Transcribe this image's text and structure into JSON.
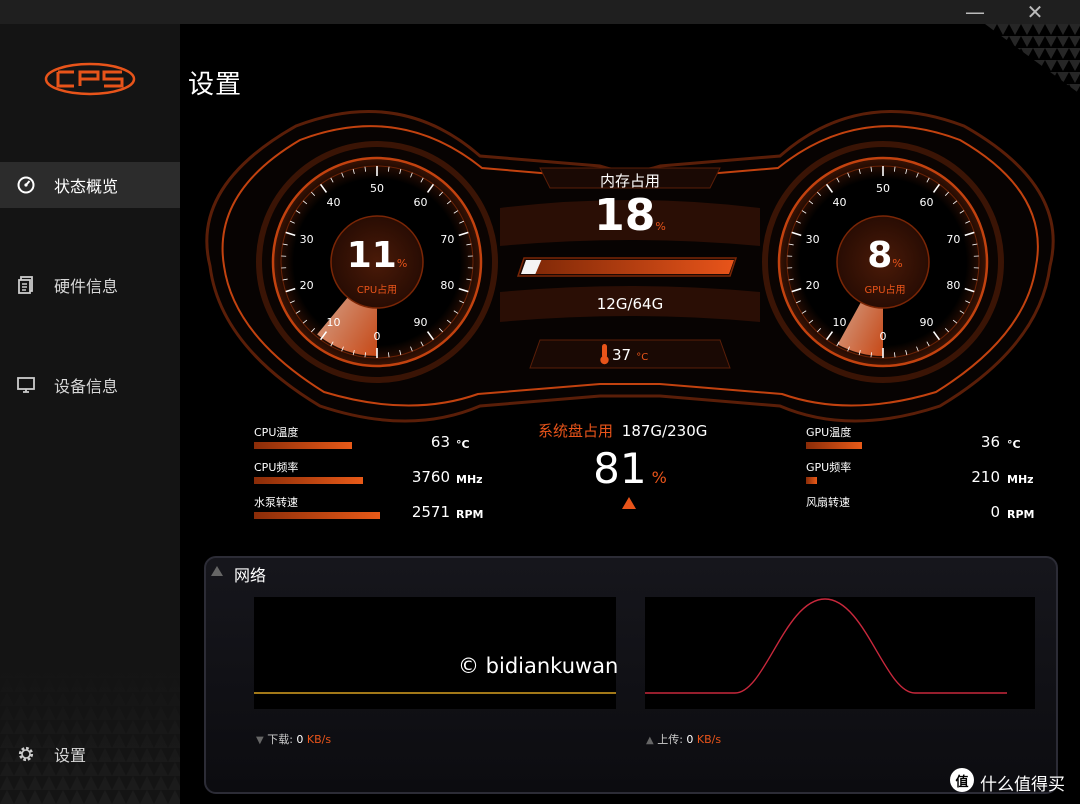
{
  "window": {
    "minimize_symbol": "—",
    "close_symbol": "✕"
  },
  "brand": {
    "logo_text": "CPS"
  },
  "sidebar": {
    "items": [
      {
        "label": "状态概览",
        "icon": "speedometer-icon",
        "active": true
      },
      {
        "label": "硬件信息",
        "icon": "document-icon",
        "active": false
      },
      {
        "label": "设备信息",
        "icon": "monitor-icon",
        "active": false
      }
    ],
    "settings_label": "设置"
  },
  "page": {
    "title": "设置"
  },
  "cpu": {
    "usage": "11",
    "usage_unit": "%",
    "gauge_label": "CPU占用",
    "gauge_ticks": [
      "0",
      "10",
      "20",
      "30",
      "40",
      "50",
      "60",
      "70",
      "80",
      "90"
    ],
    "temp_label": "CPU温度",
    "temp": "63",
    "temp_unit": "°C",
    "temp_level": 0.7,
    "freq_label": "CPU频率",
    "freq": "3760",
    "freq_unit": "MHz",
    "freq_level": 0.78,
    "pump_label": "水泵转速",
    "pump": "2571",
    "pump_unit": "RPM",
    "pump_level": 0.9
  },
  "gpu": {
    "usage": "8",
    "usage_unit": "%",
    "gauge_label": "GPU占用",
    "gauge_ticks": [
      "0",
      "10",
      "20",
      "30",
      "40",
      "50",
      "60",
      "70",
      "80",
      "90"
    ],
    "temp_label": "GPU温度",
    "temp": "36",
    "temp_unit": "°C",
    "temp_level": 0.4,
    "freq_label": "GPU频率",
    "freq": "210",
    "freq_unit": "MHz",
    "freq_level": 0.08,
    "fan_label": "风扇转速",
    "fan": "0",
    "fan_unit": "RPM",
    "fan_level": 0
  },
  "memory": {
    "label": "内存占用",
    "usage": "18",
    "usage_unit": "%",
    "amount": "12G/64G",
    "level": 0.18,
    "temp": "37",
    "temp_unit": "°C"
  },
  "disk": {
    "label": "系统盘占用",
    "amount": "187G/230G",
    "usage": "81",
    "usage_unit": "%"
  },
  "network": {
    "title": "网络",
    "download_label": "下载:",
    "download_value": "0",
    "download_unit": "KB/s",
    "upload_label": "上传:",
    "upload_value": "0",
    "upload_unit": "KB/s"
  },
  "watermarks": {
    "center": "© bidiankuwan",
    "corner_badge": "值",
    "corner_text": "什么值得买"
  },
  "colors": {
    "accent": "#e8541a",
    "background": "#000000",
    "sidebar": "#141414",
    "upload_line": "#c8283c",
    "download_line": "#d8a020"
  }
}
